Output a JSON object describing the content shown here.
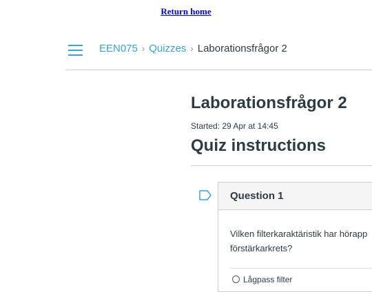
{
  "top_link": {
    "label": "Return home"
  },
  "breadcrumb": {
    "items": [
      "EEN075",
      "Quizzes",
      "Laborationsfrågor 2"
    ],
    "separator": "›"
  },
  "quiz": {
    "title": "Laborationsfrågor 2",
    "started": "Started: 29 Apr at 14:45",
    "instructions_heading": "Quiz instructions"
  },
  "question": {
    "header": "Question 1",
    "text_line1": "Vilken filterkaraktäristik har hörapp",
    "text_line2": "förstärkarkrets?",
    "first_option": "Lågpass filter"
  },
  "icons": {
    "menu": "hamburger-menu-icon",
    "flag": "flag-question-icon"
  },
  "colors": {
    "link": "#0000ee",
    "accent": "#3aa3d8",
    "text": "#2d3b45",
    "rule": "#c7cdd1"
  }
}
